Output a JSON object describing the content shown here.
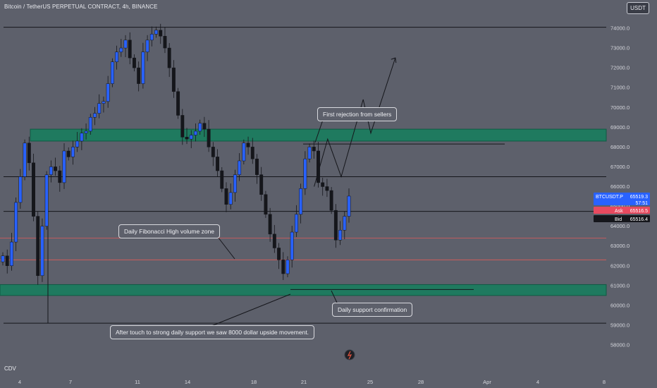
{
  "header": {
    "title": "Bitcoin / TetherUS PERPETUAL CONTRACT, 4h, BINANCE",
    "currency_button": "USDT"
  },
  "indicator_label": "CDV",
  "price_badges": {
    "symbol": "BTCUSDT.P",
    "last": "65519.3",
    "countdown": "57:51",
    "ask_label": "Ask",
    "ask": "65516.5",
    "bid_label": "Bid",
    "bid": "65516.4"
  },
  "annotations": {
    "first_rejection": "First rejection from sellers",
    "fib_zone": "Daily Fibonacci High volume zone",
    "support_confirmation": "Daily support confirmation",
    "touch_support": "After touch to strong daily support we saw 8000 dollar upside movement."
  },
  "colors": {
    "background": "#5d606b",
    "zone": "#1f7a5f",
    "up_candle": "#2962ff",
    "down_candle": "#15161b",
    "red_line": "#e05a5a",
    "ask": "#e84a5f",
    "bid": "#15161b",
    "last_price": "#2962ff"
  },
  "chart_data": {
    "type": "candlestick",
    "title": "Bitcoin / TetherUS PERPETUAL CONTRACT, 4h, BINANCE",
    "y_axis": {
      "ticks": [
        "74000.0",
        "73000.0",
        "72000.0",
        "71000.0",
        "70000.0",
        "69000.0",
        "68000.0",
        "67000.0",
        "66000.0",
        "65000.0",
        "64000.0",
        "63000.0",
        "62000.0",
        "61000.0",
        "60000.0",
        "59000.0",
        "58000.0"
      ],
      "range": [
        57200,
        74400
      ]
    },
    "x_axis": {
      "ticks": [
        "4",
        "7",
        "11",
        "14",
        "18",
        "21",
        "25",
        "28",
        "Apr",
        "4",
        "8"
      ]
    },
    "zones": [
      {
        "name": "supply-zone",
        "from": 68300,
        "to": 68900
      },
      {
        "name": "daily-support-zone",
        "from": 60500,
        "to": 61050
      }
    ],
    "horizontal_lines": [
      74050,
      66500,
      64750,
      59100
    ],
    "red_levels": [
      63400,
      62300
    ],
    "closes": [
      62500,
      62000,
      63200,
      65200,
      66500,
      68200,
      67200,
      64500,
      61500,
      64000,
      66600,
      67000,
      66800,
      66200,
      67800,
      67500,
      68000,
      68300,
      68700,
      68800,
      69500,
      69700,
      70200,
      70300,
      71200,
      72300,
      72800,
      73000,
      73400,
      72500,
      72000,
      71200,
      72800,
      73400,
      73700,
      73900,
      73600,
      73000,
      72000,
      70800,
      69600,
      68500,
      68400,
      68600,
      68800,
      69200,
      68900,
      68000,
      67500,
      66800,
      65900,
      65100,
      65700,
      66600,
      67300,
      68200,
      68000,
      67400,
      66600,
      65600,
      64600,
      63600,
      62900,
      62300,
      61600,
      62300,
      63700,
      64600,
      65900,
      67400,
      68000,
      67800,
      66200,
      66000,
      65800,
      64800,
      63300,
      63800,
      64500,
      65519.3
    ],
    "forecast_path": [
      {
        "time": 21.4,
        "price": 66000
      },
      {
        "time": 22.2,
        "price": 68400
      },
      {
        "time": 23.0,
        "price": 66500
      },
      {
        "time": 24.3,
        "price": 70400
      },
      {
        "time": 24.75,
        "price": 68700
      },
      {
        "time": 26.2,
        "price": 72500
      }
    ],
    "last_price": 65519.3,
    "ask": 65516.5,
    "bid": 65516.4
  }
}
